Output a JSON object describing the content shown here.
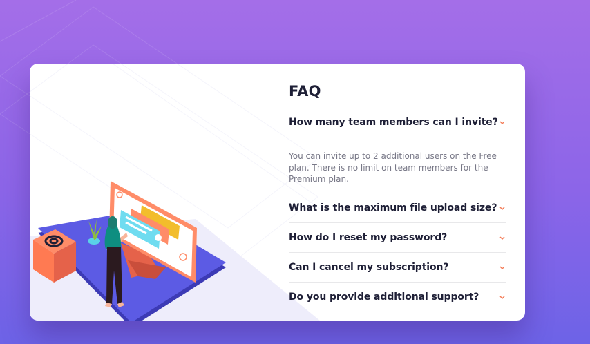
{
  "faq": {
    "title": "FAQ",
    "items": [
      {
        "question": "How many team members can I invite?",
        "answer": "You can invite up to 2 additional users on the Free plan. There is no limit on team members for the Premium plan.",
        "expanded": true
      },
      {
        "question": "What is the maximum file upload size?",
        "expanded": false
      },
      {
        "question": "How do I reset my password?",
        "expanded": false
      },
      {
        "question": "Can I cancel my subscription?",
        "expanded": false
      },
      {
        "question": "Do you provide additional support?",
        "expanded": false
      }
    ]
  },
  "colors": {
    "background_top": "#a46ee8",
    "background_bottom": "#6d63e7",
    "card": "#ffffff",
    "heading": "#1e1f36",
    "answer_text": "#787887",
    "chevron": "#f47c57",
    "divider": "#e8e8ea",
    "platform": "#5c5be4"
  },
  "icons": {
    "chevron": "chevron-down-icon",
    "box": "at-sign-box-icon"
  }
}
